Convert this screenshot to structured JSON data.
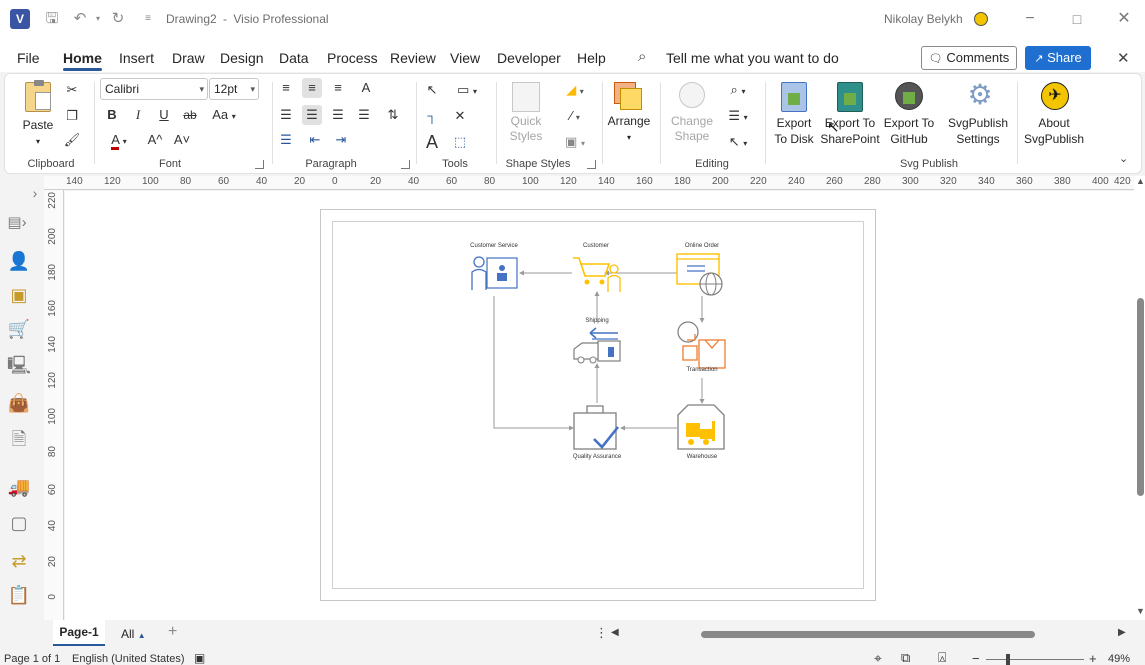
{
  "titlebar": {
    "document": "Drawing2",
    "separator": "-",
    "app": "Visio Professional",
    "user": "Nikolay Belykh"
  },
  "menu": {
    "tabs": [
      "File",
      "Home",
      "Insert",
      "Draw",
      "Design",
      "Data",
      "Process",
      "Review",
      "View",
      "Developer",
      "Help"
    ],
    "active": "Home",
    "tell_me": "Tell me what you want to do",
    "comments": "Comments",
    "share": "Share"
  },
  "ribbon": {
    "clipboard": {
      "paste": "Paste",
      "label": "Clipboard"
    },
    "font": {
      "name": "Calibri",
      "size": "12pt",
      "label": "Font",
      "bold": "B",
      "italic": "I",
      "underline": "U",
      "strike": "ab",
      "case": "Aa",
      "color": "A",
      "grow": "A^",
      "shrink": "A˅"
    },
    "paragraph": {
      "label": "Paragraph"
    },
    "tools": {
      "label": "Tools",
      "text": "A"
    },
    "shape_styles": {
      "quick_styles": "Quick Styles",
      "label": "Shape Styles"
    },
    "arrange": {
      "label": "Arrange"
    },
    "editing": {
      "change_shape": "Change Shape",
      "label": "Editing"
    },
    "svgpublish": {
      "label": "Svg Publish",
      "buttons": [
        {
          "line1": "Export",
          "line2": "To Disk"
        },
        {
          "line1": "Export To",
          "line2": "SharePoint"
        },
        {
          "line1": "Export To",
          "line2": "GitHub"
        },
        {
          "line1": "SvgPublish",
          "line2": "Settings"
        },
        {
          "line1": "About",
          "line2": "SvgPublish"
        }
      ]
    },
    "colors": {
      "accent": "#2b579a",
      "share_bg": "#1f6fd0"
    }
  },
  "rulers": {
    "horizontal": [
      "140",
      "120",
      "100",
      "80",
      "60",
      "40",
      "20",
      "0",
      "20",
      "40",
      "60",
      "80",
      "100",
      "120",
      "140",
      "160",
      "180",
      "200",
      "220",
      "240",
      "260",
      "280",
      "300",
      "320",
      "340",
      "360",
      "380",
      "400",
      "420"
    ],
    "vertical": [
      "220",
      "200",
      "180",
      "160",
      "140",
      "120",
      "100",
      "80",
      "60",
      "40",
      "20",
      "0"
    ]
  },
  "diagram": {
    "shapes": [
      {
        "name": "Customer Service",
        "label_pos": "top"
      },
      {
        "name": "Customer",
        "label_pos": "top"
      },
      {
        "name": "Online Order",
        "label_pos": "top"
      },
      {
        "name": "Shipping",
        "label_pos": "top"
      },
      {
        "name": "Transaction",
        "label_pos": "bottom"
      },
      {
        "name": "Quality Assurance",
        "label_pos": "bottom"
      },
      {
        "name": "Warehouse",
        "label_pos": "bottom"
      }
    ],
    "colors": {
      "blue": "#4472c4",
      "gold": "#ffc000",
      "orange": "#ed7d31",
      "gray": "#7f7f7f"
    }
  },
  "tabs": {
    "page": "Page-1",
    "all": "All",
    "add": "+"
  },
  "status": {
    "page_info": "Page 1 of 1",
    "language": "English (United States)",
    "zoom_minus": "−",
    "zoom_plus": "+",
    "zoom": "49%",
    "zoom_fraction": 0.49
  }
}
